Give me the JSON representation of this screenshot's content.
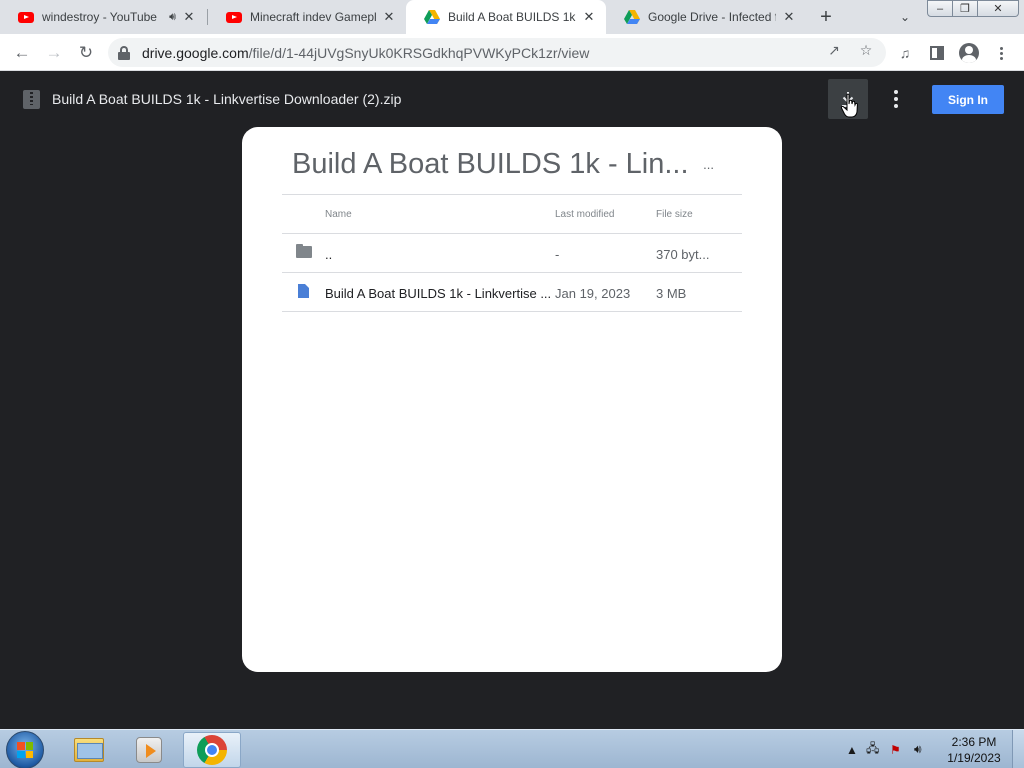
{
  "browser": {
    "tabs": [
      {
        "title": "windestroy - YouTube",
        "icon": "youtube-icon",
        "audio": true
      },
      {
        "title": "Minecraft indev Gamepla",
        "icon": "youtube-icon"
      },
      {
        "title": "Build A Boat BUILDS 1k -",
        "icon": "google-drive-icon",
        "active": true
      },
      {
        "title": "Google Drive - Infected f",
        "icon": "google-drive-icon"
      }
    ],
    "new_tab_symbol": "+",
    "address": {
      "host": "drive.google.com",
      "path": "/file/d/1-44jUVgSnyUk0KRSGdkhqPVWKyPCk1zr/view"
    }
  },
  "viewer": {
    "file_title": "Build A Boat BUILDS 1k - Linkvertise Downloader (2).zip",
    "sign_in_label": "Sign In"
  },
  "archive": {
    "title": "Build A Boat BUILDS 1k - Lin...",
    "more": "...",
    "columns": {
      "name": "Name",
      "modified": "Last modified",
      "size": "File size"
    },
    "rows": [
      {
        "type": "folder",
        "name": "..",
        "modified": "-",
        "size": "370 byt..."
      },
      {
        "type": "file",
        "name": "Build A Boat BUILDS 1k - Linkvertise ...",
        "modified": "Jan 19, 2023",
        "size": "3 MB"
      }
    ]
  },
  "taskbar": {
    "clock_time": "2:36 PM",
    "clock_date": "1/19/2023"
  },
  "colors": {
    "accent": "#4285f4",
    "viewer_background": "#202124",
    "tab_strip": "#dee1e6"
  }
}
